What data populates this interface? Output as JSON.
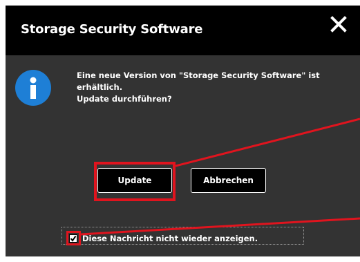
{
  "dialog": {
    "title": "Storage Security Software",
    "close_icon": "close-icon",
    "info_icon": "info-icon",
    "message_lines": [
      "Eine neue Version von \"Storage Security Software\" ist",
      "erhältlich.",
      "Update durchführen?"
    ],
    "buttons": {
      "update_label": "Update",
      "cancel_label": "Abbrechen"
    },
    "dont_show": {
      "label": "Diese Nachricht nicht wieder anzeigen.",
      "checked": true
    }
  },
  "colors": {
    "titlebar": "#000000",
    "body": "#333333",
    "text": "#ffffff",
    "info_blue": "#1e7fd6",
    "annotation_red": "#e0141e"
  }
}
